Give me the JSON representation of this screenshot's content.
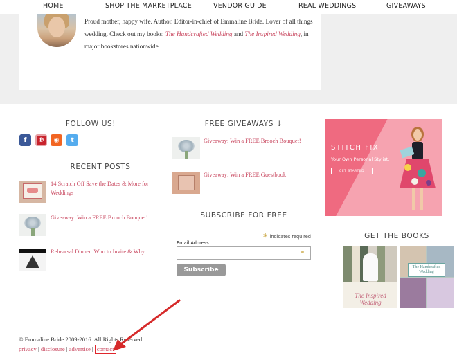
{
  "nav": {
    "items": [
      "HOME",
      "SHOP THE MARKETPLACE",
      "VENDOR GUIDE",
      "REAL WEDDINGS",
      "GIVEAWAYS"
    ]
  },
  "bio": {
    "text_before": "Proud mother, happy wife. Author. Editor-in-chief of Emmaline Bride. Lover of all things wedding. Check out my books: ",
    "book1": "The Handcrafted Wedding",
    "and": " and ",
    "book2": "The Inspired Wedding",
    "text_after": ", in major bookstores nationwide."
  },
  "follow": {
    "title": "FOLLOW US!",
    "icons": [
      {
        "name": "facebook-icon",
        "glyph": "f",
        "color": "#3b5998"
      },
      {
        "name": "pinterest-icon",
        "glyph": "℗",
        "color": "#c8232c"
      },
      {
        "name": "rss-icon",
        "glyph": "◉",
        "color": "#f26522"
      },
      {
        "name": "twitter-icon",
        "glyph": "t",
        "color": "#55acee"
      }
    ]
  },
  "recent_posts": {
    "title": "RECENT POSTS",
    "items": [
      {
        "title": "14 Scratch Off Save the Dates & More for Weddings"
      },
      {
        "title": "Giveaway: Win a FREE Brooch Bouquet!"
      },
      {
        "title": "Rehearsal Dinner: Who to Invite & Why"
      }
    ]
  },
  "giveaways": {
    "title": "FREE GIVEAWAYS ↓",
    "items": [
      {
        "title": "Giveaway: Win a FREE Brooch Bouquet!"
      },
      {
        "title": "Giveaway: Win a FREE Guestbook!"
      }
    ]
  },
  "subscribe": {
    "title": "SUBSCRIBE FOR FREE",
    "required_note": "indicates required",
    "email_label": "Email Address",
    "email_value": "",
    "button": "Subscribe"
  },
  "ad": {
    "brand": "STITCH FIX",
    "tagline": "Your Own Personal Stylist.",
    "cta": "GET STARTED"
  },
  "books": {
    "title": "GET THE BOOKS",
    "book1_cover": "The Inspired Wedding",
    "book2_cover": "The Handcrafted Wedding"
  },
  "footer": {
    "copyright": "© Emmaline Bride 2009-2016. All Rights Reserved.",
    "links": [
      "privacy",
      "disclosure",
      "advertise",
      "contact"
    ]
  }
}
